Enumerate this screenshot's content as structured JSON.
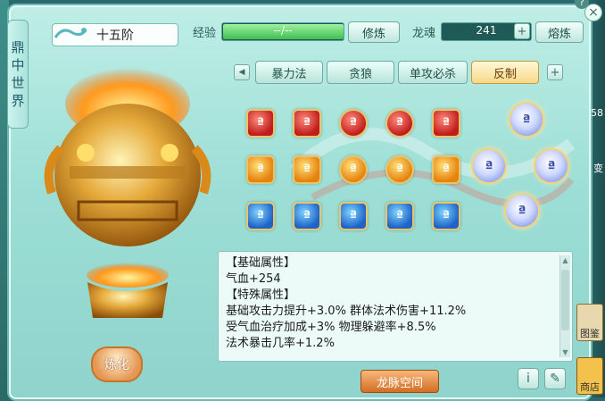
{
  "side_tab": {
    "chars": [
      "鼎",
      "中",
      "世",
      "界"
    ]
  },
  "rank": {
    "label": "十五阶"
  },
  "experience": {
    "label": "经验",
    "value_text": "--/--",
    "fill": 1.0,
    "button": "修炼"
  },
  "longhun": {
    "label": "龙魂",
    "value": "241",
    "add_button": "+",
    "button": "熔炼"
  },
  "tabs": {
    "prev": "◀",
    "items": [
      "暴力法",
      "贪狼",
      "单攻必杀",
      "反制"
    ],
    "active_index": 3,
    "add": "+"
  },
  "gems": {
    "symbol": "ª",
    "row1": [
      "red",
      "red",
      "red",
      "red",
      "red"
    ],
    "row2": [
      "orange",
      "orange",
      "orange",
      "orange",
      "orange"
    ],
    "row3": [
      "blue",
      "blue",
      "blue",
      "blue",
      "blue"
    ]
  },
  "attributes": {
    "lines": [
      "【基础属性】",
      "气血+254",
      "【特殊属性】",
      "基础攻击力提升+3.0%  群体法术伤害+11.2%",
      "受气血治疗加成+3%  物理躲避率+8.5%",
      "法术暴击几率+1.2%"
    ]
  },
  "buttons": {
    "refine": "炼化",
    "longmai": "龙脉空间",
    "info": "i",
    "edit": "✎",
    "help": "?",
    "close": "×"
  },
  "right_panel": {
    "labels": [
      "图鉴",
      "商店"
    ],
    "side_text": [
      "58",
      "变"
    ]
  }
}
